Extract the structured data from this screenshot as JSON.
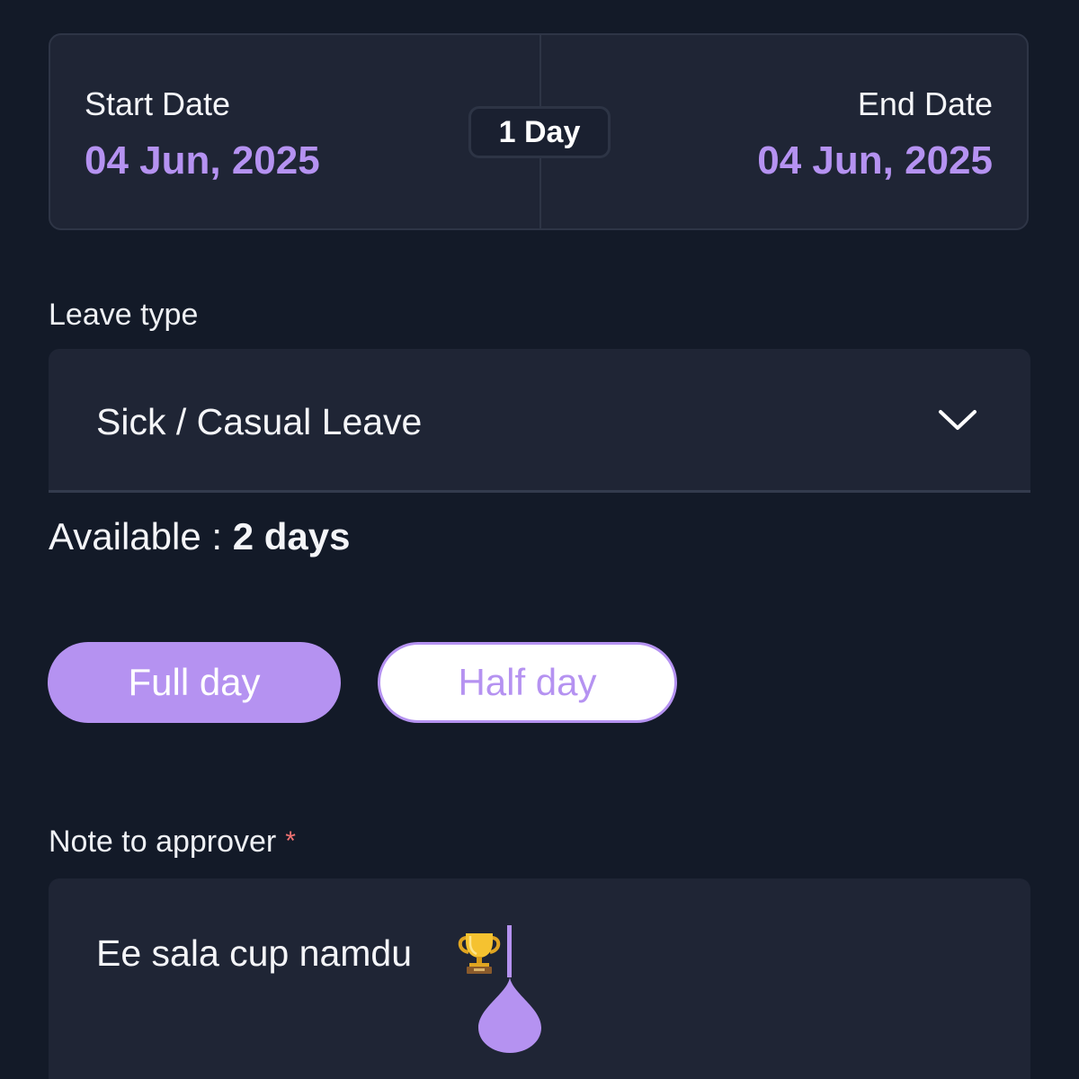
{
  "date_range": {
    "start_label": "Start Date",
    "start_value": "04 Jun, 2025",
    "end_label": "End Date",
    "end_value": "04 Jun, 2025",
    "duration": "1 Day"
  },
  "leave_type": {
    "label": "Leave type",
    "selected": "Sick / Casual Leave",
    "icon": "chevron-down-icon"
  },
  "availability": {
    "prefix": "Available : ",
    "count": "2 days"
  },
  "day_toggle": {
    "full_label": "Full day",
    "half_label": "Half day",
    "selected": "Full day"
  },
  "note": {
    "label": "Note to approver",
    "required_marker": "*",
    "value": "Ee sala cup namdu",
    "emoji_icon": "trophy-icon"
  },
  "colors": {
    "background": "#131a28",
    "card": "#1f2535",
    "accent": "#b592f1",
    "required": "#f07272"
  }
}
